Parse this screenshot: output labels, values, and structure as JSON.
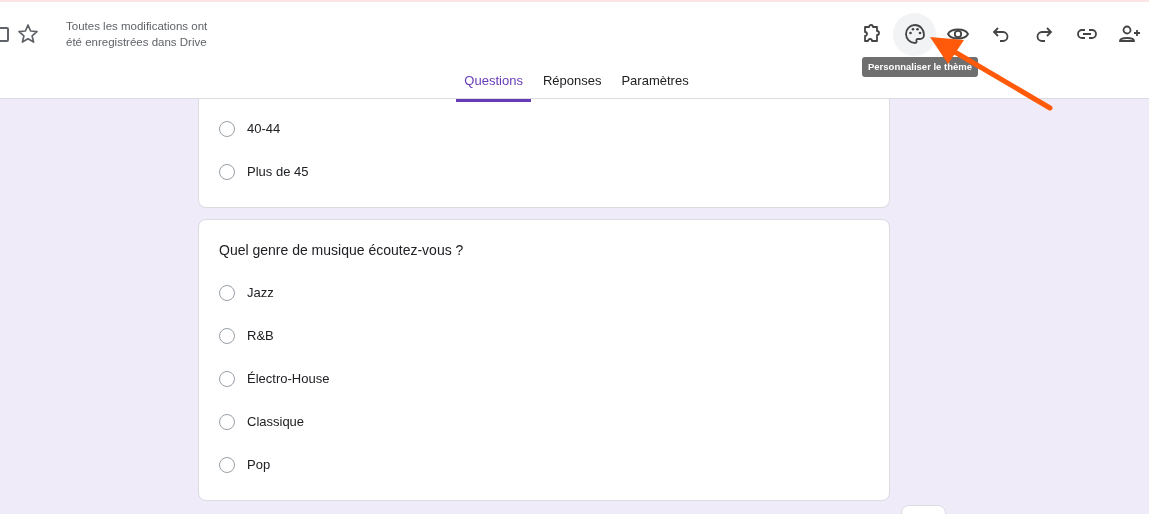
{
  "header": {
    "save_status": "Toutes les modifications ont été enregistrées dans Drive",
    "tooltip": "Personnaliser le thème"
  },
  "tabs": [
    {
      "label": "Questions",
      "selected": true
    },
    {
      "label": "Réponses",
      "selected": false
    },
    {
      "label": "Paramètres",
      "selected": false
    }
  ],
  "questions": [
    {
      "options": [
        {
          "label": "40-44",
          "selected": false
        },
        {
          "label": "Plus de 45",
          "selected": false
        }
      ]
    },
    {
      "title": "Quel genre de musique écoutez-vous ?",
      "options": [
        {
          "label": "Jazz",
          "selected": false
        },
        {
          "label": "R&B",
          "selected": false
        },
        {
          "label": "Électro-House",
          "selected": false
        },
        {
          "label": "Classique",
          "selected": false
        },
        {
          "label": "Pop",
          "selected": false
        }
      ]
    }
  ]
}
